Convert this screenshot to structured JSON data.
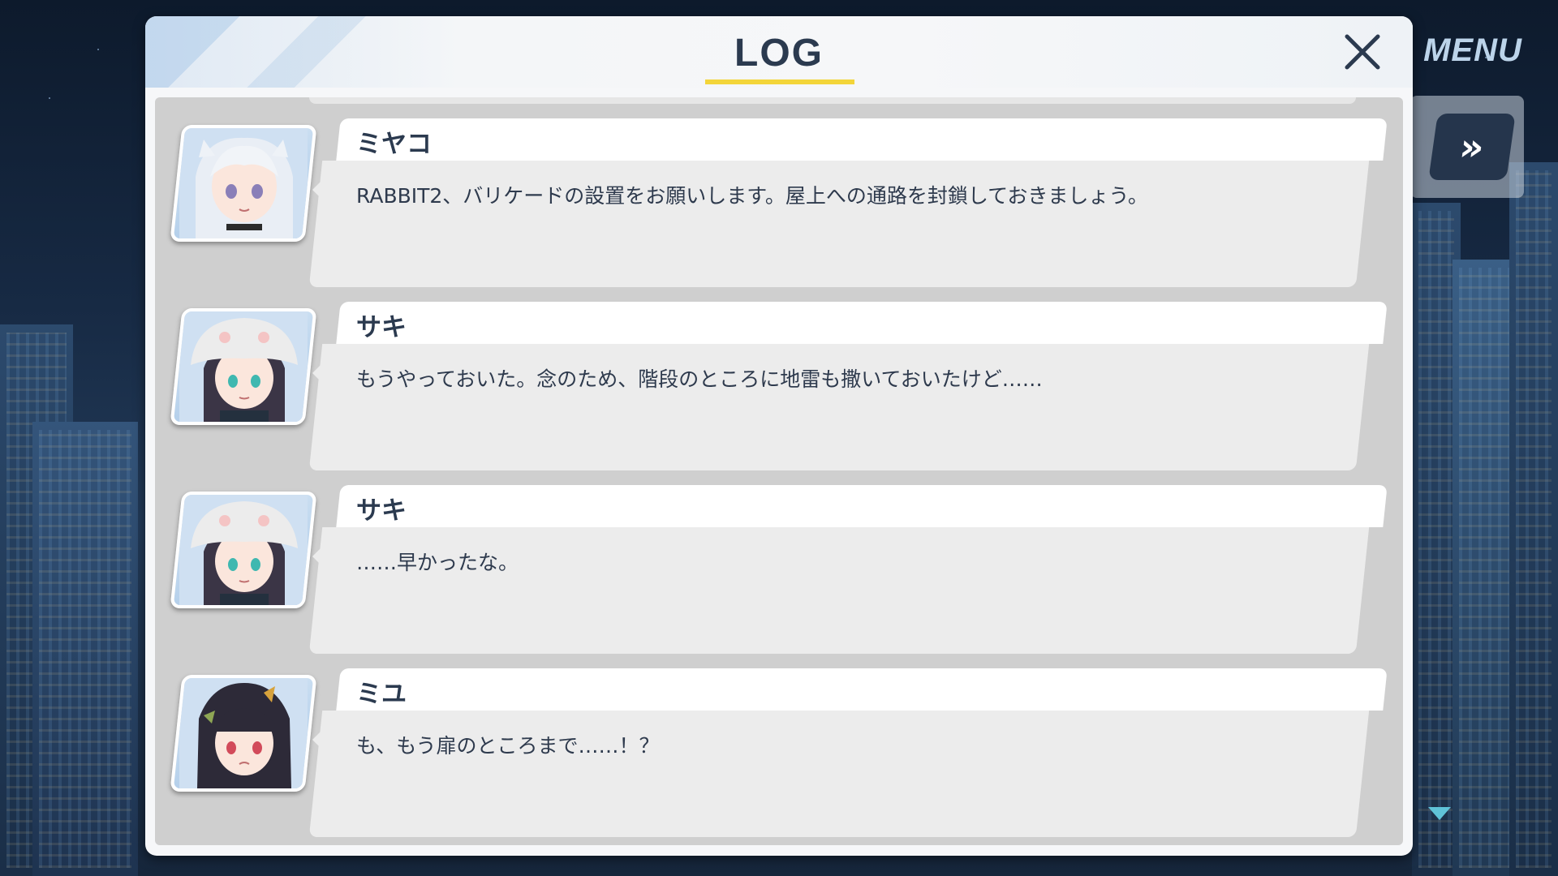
{
  "header": {
    "title": "LOG"
  },
  "controls": {
    "menu_label": "MENU",
    "fast_forward_symbol": "»",
    "close_icon": "close-icon",
    "scroll_icon": "scroll-down-icon"
  },
  "colors": {
    "title_underline": "#f3d53a",
    "title_text": "#2b3a4f",
    "name_bubble": "#ffffff",
    "text_bubble": "#ececec"
  },
  "entries": [
    {
      "speaker": "ミヤコ",
      "text": "RABBIT2、バリケードの設置をお願いします。屋上への通路を封鎖しておきましょう。",
      "portrait": "miyako-portrait"
    },
    {
      "speaker": "サキ",
      "text": "もうやっておいた。念のため、階段のところに地雷も撒いておいたけど……",
      "portrait": "saki-portrait"
    },
    {
      "speaker": "サキ",
      "text": "……早かったな。",
      "portrait": "saki-portrait"
    },
    {
      "speaker": "ミユ",
      "text": "も、もう扉のところまで……！？",
      "portrait": "miyu-portrait"
    }
  ]
}
